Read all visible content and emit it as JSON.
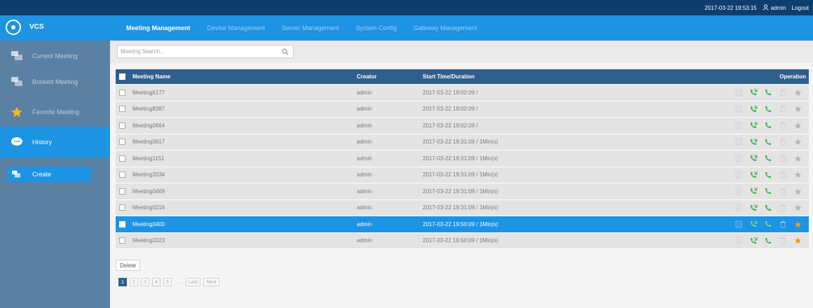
{
  "topbar": {
    "datetime": "2017-03-22 19:53:15",
    "user": "admin",
    "logout": "Logout"
  },
  "header": {
    "app_name": "VCS",
    "tabs": [
      {
        "label": "Meeting Management",
        "active": true
      },
      {
        "label": "Device Management",
        "active": false
      },
      {
        "label": "Server Management",
        "active": false
      },
      {
        "label": "System Config",
        "active": false
      },
      {
        "label": "Gateway Management",
        "active": false
      }
    ]
  },
  "sidebar": {
    "items": [
      {
        "label": "Current Meeting",
        "icon": "chat-icon",
        "active": false
      },
      {
        "label": "Booked Meeting",
        "icon": "chat-icon",
        "active": false
      },
      {
        "label": "Favorite Meeting",
        "icon": "star-icon",
        "active": false
      },
      {
        "label": "History",
        "icon": "history-icon",
        "active": true
      }
    ],
    "create_label": "Create"
  },
  "search": {
    "placeholder": "Meeting Search..."
  },
  "table": {
    "headers": {
      "name": "Meeting Name",
      "creator": "Creator",
      "time": "Start Time/Duration",
      "operation": "Operation"
    },
    "rows": [
      {
        "name": "Meeting6177",
        "creator": "admin",
        "time": "2017-03-22 19:02:09 /",
        "selected": false,
        "favorite": false
      },
      {
        "name": "Meeting8387",
        "creator": "admin",
        "time": "2017-03-22 19:02:09 /",
        "selected": false,
        "favorite": false
      },
      {
        "name": "Meeting0664",
        "creator": "admin",
        "time": "2017-03-22 19:02:09 /",
        "selected": false,
        "favorite": false
      },
      {
        "name": "Meeting0617",
        "creator": "admin",
        "time": "2017-03-22 19:31:09 / 1Min(s)",
        "selected": false,
        "favorite": false
      },
      {
        "name": "Meeting1151",
        "creator": "admin",
        "time": "2017-03-22 19:31:09 / 1Min(s)",
        "selected": false,
        "favorite": false
      },
      {
        "name": "Meeting2034",
        "creator": "admin",
        "time": "2017-03-22 19:31:09 / 1Min(s)",
        "selected": false,
        "favorite": false
      },
      {
        "name": "Meeting0469",
        "creator": "admin",
        "time": "2017-03-22 19:31:09 / 1Min(s)",
        "selected": false,
        "favorite": false
      },
      {
        "name": "Meeting0216",
        "creator": "admin",
        "time": "2017-03-22 19:31:09 / 1Min(s)",
        "selected": false,
        "favorite": false
      },
      {
        "name": "Meeting0400",
        "creator": "admin",
        "time": "2017-03-22 19:50:09 / 1Min(s)",
        "selected": true,
        "favorite": true
      },
      {
        "name": "Meeting0323",
        "creator": "admin",
        "time": "2017-03-22 19:50:09 / 1Min(s)",
        "selected": false,
        "favorite": true
      }
    ]
  },
  "delete_label": "Delete",
  "pager": {
    "pages": [
      "1",
      "2",
      "3",
      "4",
      "5"
    ],
    "active": "1",
    "ellipsis": "...",
    "last": "Last",
    "next": "Next"
  },
  "colors": {
    "topbar": "#0d3e6e",
    "header": "#1d93e4",
    "sidebar": "#5a80a3",
    "table_header": "#2e5f8e",
    "selected_row": "#1d93e4",
    "phone_green": "#3bb143",
    "star_orange": "#f39c12",
    "icon_gray": "#b5b5b5"
  }
}
